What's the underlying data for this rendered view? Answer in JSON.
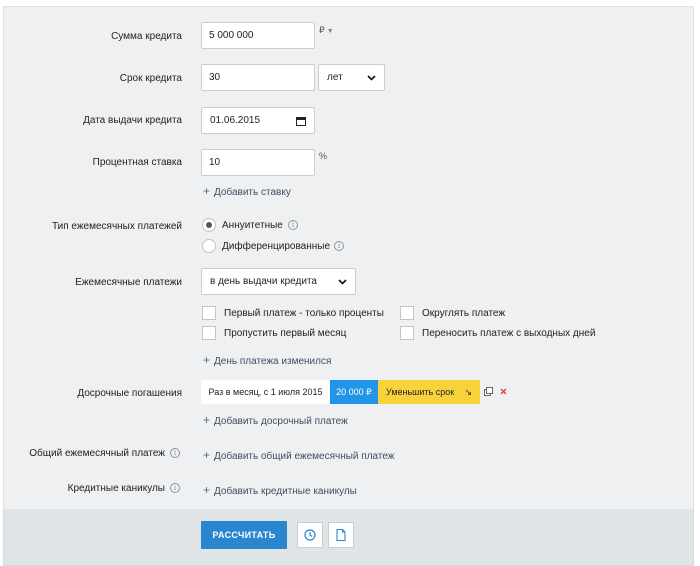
{
  "loan": {
    "amount_label": "Сумма кредита",
    "amount_value": "5 000 000",
    "currency": "₽",
    "term_label": "Срок кредита",
    "term_value": "30",
    "term_unit": "лет",
    "date_label": "Дата выдачи кредита",
    "date_value": "01.06.2015",
    "rate_label": "Процентная ставка",
    "rate_value": "10",
    "rate_unit": "%",
    "add_rate": "Добавить ставку"
  },
  "payments": {
    "type_label": "Тип ежемесячных платежей",
    "options": [
      "Аннуитетные",
      "Дифференцированные"
    ],
    "selected": "Аннуитетные",
    "monthly_label": "Ежемесячные платежи",
    "monthly_value": "в день выдачи кредита",
    "checkboxes": [
      "Первый платеж - только проценты",
      "Пропустить первый месяц",
      "Округлять платеж",
      "Переносить платеж с выходных дней"
    ],
    "day_changed": "День платежа изменился"
  },
  "early": {
    "label": "Досрочные погашения",
    "entry_text": "Раз в месяц, с 1 июля 2015",
    "entry_amount": "20 000 ₽",
    "entry_mode": "Уменьшить срок",
    "entry_mode_arrow": "↘",
    "add": "Добавить досрочный платеж"
  },
  "common": {
    "label": "Общий ежемесячный платеж",
    "add": "Добавить общий ежемесячный платеж"
  },
  "holidays": {
    "label": "Кредитные каникулы",
    "add": "Добавить кредитные каникулы"
  },
  "footer": {
    "calculate": "РАССЧИТАТЬ"
  },
  "colors": {
    "accent": "#2a86cf",
    "amount_bg": "#2196e8",
    "mode_bg": "#f7d23a",
    "panel_bg": "#eef0f1"
  }
}
